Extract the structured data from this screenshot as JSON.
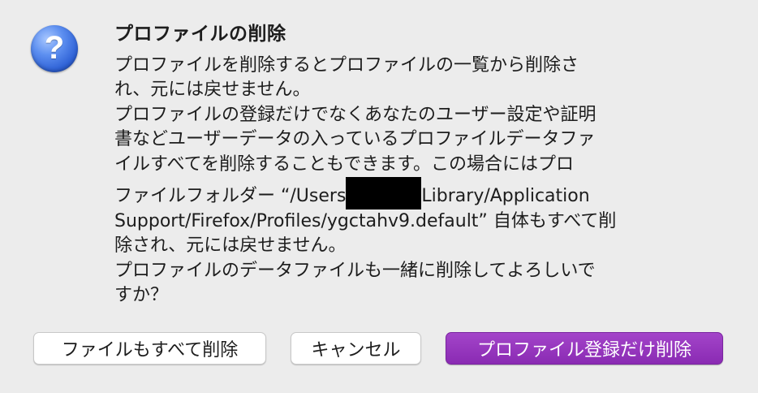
{
  "dialog": {
    "icon": "question-icon",
    "title": "プロファイルの削除",
    "message_lines": [
      "プロファイルを削除するとプロファイルの一覧から削除さ",
      "れ、元には戻せません。",
      "プロファイルの登録だけでなくあなたのユーザー設定や証明",
      "書などユーザーデータの入っているプロファイルデータファ",
      "イルすべてを削除することもできます。この場合にはプロ",
      "Library/Application",
      "Support/Firefox/Profiles/ygctahv9.default” 自体もすべて削",
      "除され、元には戻せません。",
      "プロファイルのデータファイルも一緒に削除してよろしいで",
      "すか？"
    ],
    "path_line_prefix": "ファイルフォルダー “/Users",
    "buttons": {
      "delete_files": "ファイルもすべて削除",
      "cancel": "キャンセル",
      "remove_only": "プロファイル登録だけ削除"
    },
    "accent_color": "#9a36c2"
  }
}
